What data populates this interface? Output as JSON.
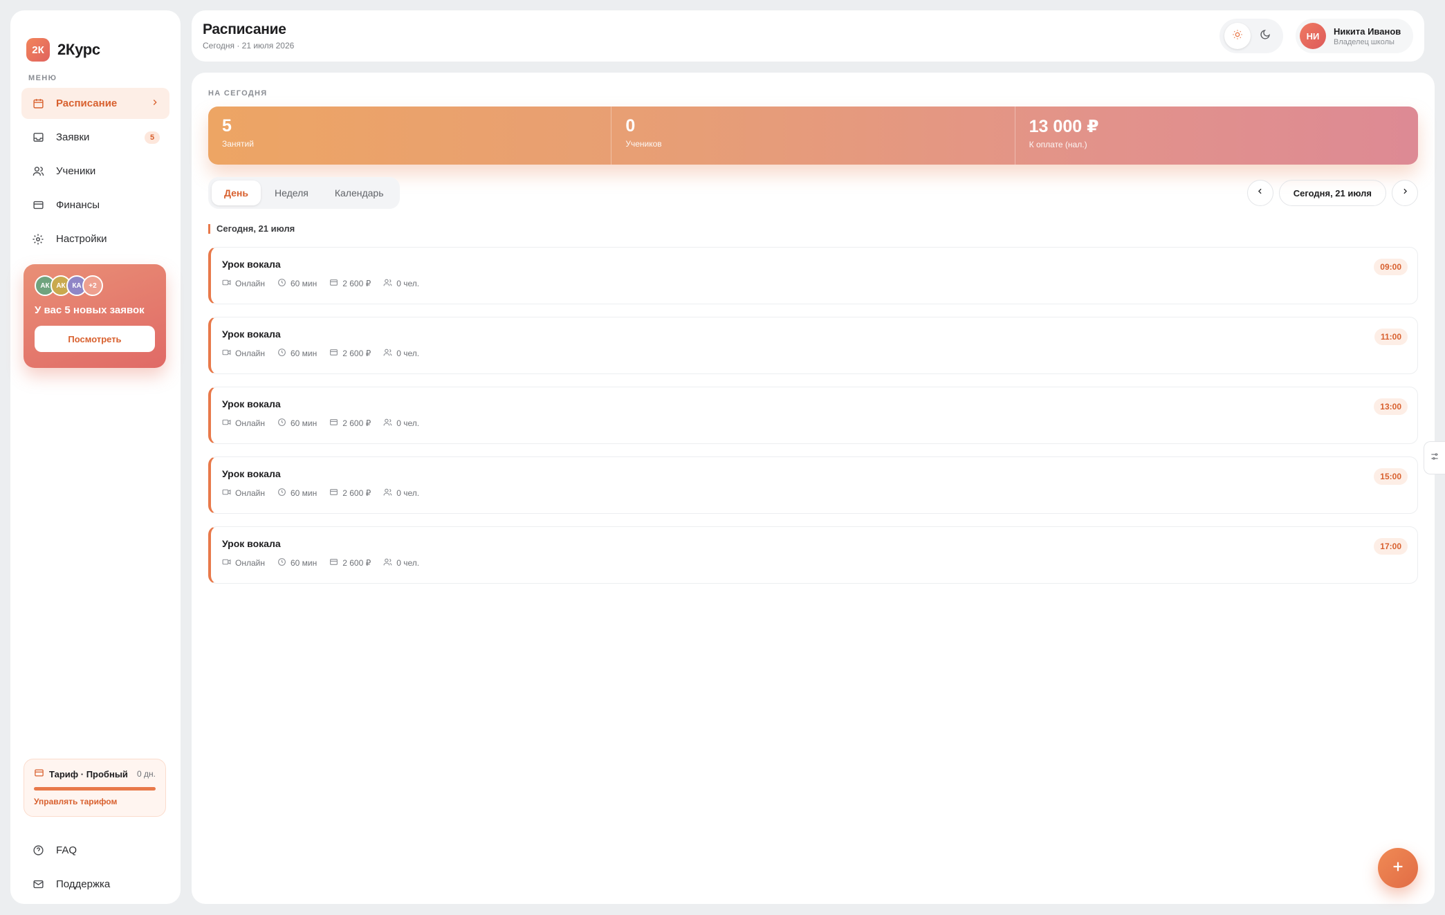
{
  "app": {
    "logo": "2К",
    "name": "2Курс"
  },
  "menu_label": "МЕНЮ",
  "menu": [
    {
      "label": "Расписание",
      "icon": "calendar-icon",
      "active": true
    },
    {
      "label": "Заявки",
      "icon": "inbox-icon",
      "badge": "5"
    },
    {
      "label": "Ученики",
      "icon": "users-icon"
    },
    {
      "label": "Финансы",
      "icon": "wallet-icon"
    },
    {
      "label": "Настройки",
      "icon": "gear-icon"
    }
  ],
  "promo": {
    "avatars": [
      "АК",
      "АК",
      "КА",
      "+2"
    ],
    "text": "У вас 5 новых заявок",
    "button": "Посмотреть"
  },
  "plan": {
    "title": "Тариф · Пробный",
    "days": "0 дн.",
    "progress": 1.0,
    "link": "Управлять тарифом"
  },
  "bottom_links": [
    {
      "label": "FAQ",
      "icon": "help-icon"
    },
    {
      "label": "Поддержка",
      "icon": "mail-icon"
    }
  ],
  "header": {
    "title": "Расписание",
    "subtitle": "Сегодня · 21 июля 2026",
    "user": {
      "initials": "НИ",
      "name": "Никита Иванов",
      "role": "Владелец школы"
    }
  },
  "today_label": "НА СЕГОДНЯ",
  "stats": [
    {
      "value": "5",
      "label": "Занятий"
    },
    {
      "value": "0",
      "label": "Учеников"
    },
    {
      "value": "13 000 ₽",
      "label": "К оплате (нал.)"
    }
  ],
  "tabs": [
    "День",
    "Неделя",
    "Календарь"
  ],
  "active_tab": "День",
  "date_pill": "Сегодня, 21 июля",
  "day_heading": "Сегодня, 21 июля",
  "lessons": [
    {
      "title": "Урок вокала",
      "mode": "Онлайн",
      "duration": "60 мин",
      "price": "2 600 ₽",
      "people": "0 чел.",
      "time": "09:00"
    },
    {
      "title": "Урок вокала",
      "mode": "Онлайн",
      "duration": "60 мин",
      "price": "2 600 ₽",
      "people": "0 чел.",
      "time": "11:00"
    },
    {
      "title": "Урок вокала",
      "mode": "Онлайн",
      "duration": "60 мин",
      "price": "2 600 ₽",
      "people": "0 чел.",
      "time": "13:00"
    },
    {
      "title": "Урок вокала",
      "mode": "Онлайн",
      "duration": "60 мин",
      "price": "2 600 ₽",
      "people": "0 чел.",
      "time": "15:00"
    },
    {
      "title": "Урок вокала",
      "mode": "Онлайн",
      "duration": "60 мин",
      "price": "2 600 ₽",
      "people": "0 чел.",
      "time": "17:00"
    }
  ],
  "colors": {
    "accent": "#e8794a",
    "accent_text": "#d8602e",
    "page_bg": "#eceef0"
  }
}
